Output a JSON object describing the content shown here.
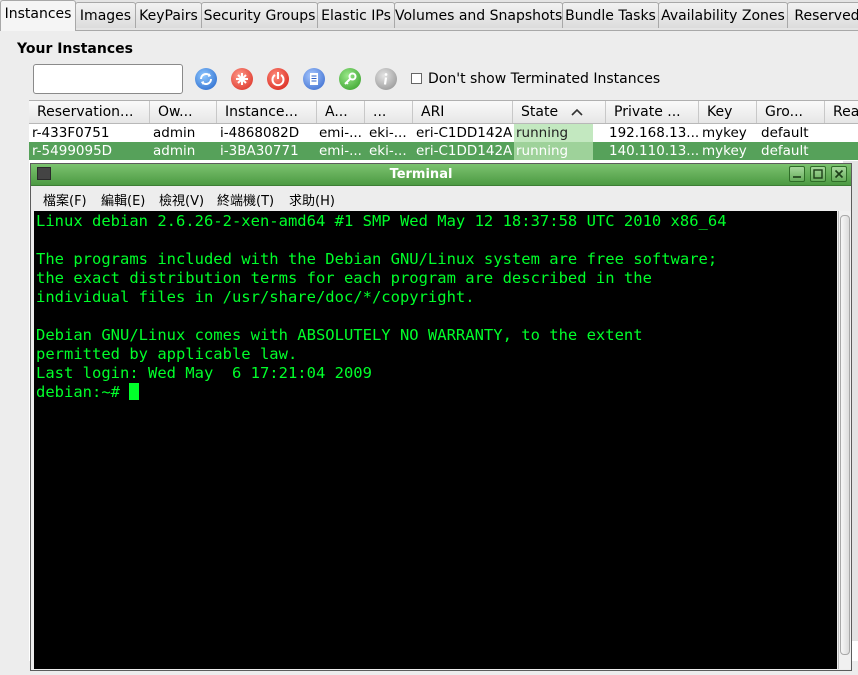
{
  "tabs": [
    "Instances",
    "Images",
    "KeyPairs",
    "Security Groups",
    "Elastic IPs",
    "Volumes and Snapshots",
    "Bundle Tasks",
    "Availability Zones",
    "Reserved"
  ],
  "heading": "Your Instances",
  "search": {
    "value": ""
  },
  "toolbar_icons": [
    "refresh-icon",
    "launch-icon",
    "stop-icon",
    "console-icon",
    "connect-icon",
    "info-icon"
  ],
  "checkbox": {
    "label": "Don't show Terminated Instances",
    "checked": false
  },
  "table": {
    "columns": [
      "Reservation...",
      "Ow...",
      "Instance...",
      "A...",
      "...",
      "ARI",
      "State",
      "Private ...",
      "Key",
      "Gro...",
      "Rea"
    ],
    "rows": [
      {
        "reservation": "r-433F0751",
        "owner": "admin",
        "instance": "i-4868082D",
        "ami": "emi-...",
        "aki": "eki-...",
        "ari": "eri-C1DD142A",
        "state": "running",
        "private": "192.168.13...",
        "key": "mykey",
        "group": "default",
        "selected": false
      },
      {
        "reservation": "r-5499095D",
        "owner": "admin",
        "instance": "i-3BA30771",
        "ami": "emi-...",
        "aki": "eki-...",
        "ari": "eri-C1DD142A",
        "state": "running",
        "private": "140.110.13...",
        "key": "mykey",
        "group": "default",
        "selected": true
      }
    ]
  },
  "terminal": {
    "title": "Terminal",
    "menu": [
      "檔案(F)",
      "編輯(E)",
      "檢視(V)",
      "終端機(T)",
      "求助(H)"
    ],
    "lines": [
      "Linux debian 2.6.26-2-xen-amd64 #1 SMP Wed May 12 18:37:58 UTC 2010 x86_64",
      "",
      "The programs included with the Debian GNU/Linux system are free software;",
      "the exact distribution terms for each program are described in the",
      "individual files in /usr/share/doc/*/copyright.",
      "",
      "Debian GNU/Linux comes with ABSOLUTELY NO WARRANTY, to the extent",
      "permitted by applicable law.",
      "Last login: Wed May  6 17:21:04 2009"
    ],
    "prompt": "debian:~# "
  },
  "colors": {
    "accent": "#56a15a",
    "terminal_text": "#00ff2a",
    "terminal_bg": "#000000",
    "running": "#c3e8c0"
  }
}
